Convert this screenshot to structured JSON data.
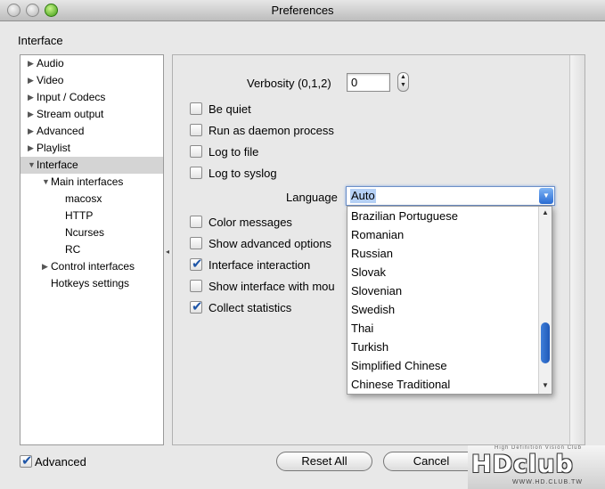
{
  "window": {
    "title": "Preferences"
  },
  "section_title": "Interface",
  "tree": [
    {
      "label": "Audio",
      "arrow": "▶",
      "level": 0,
      "selected": false
    },
    {
      "label": "Video",
      "arrow": "▶",
      "level": 0,
      "selected": false
    },
    {
      "label": "Input / Codecs",
      "arrow": "▶",
      "level": 0,
      "selected": false
    },
    {
      "label": "Stream output",
      "arrow": "▶",
      "level": 0,
      "selected": false
    },
    {
      "label": "Advanced",
      "arrow": "▶",
      "level": 0,
      "selected": false
    },
    {
      "label": "Playlist",
      "arrow": "▶",
      "level": 0,
      "selected": false
    },
    {
      "label": "Interface",
      "arrow": "▼",
      "level": 0,
      "selected": true
    },
    {
      "label": "Main interfaces",
      "arrow": "▼",
      "level": 1,
      "selected": false
    },
    {
      "label": "macosx",
      "arrow": "",
      "level": 2,
      "selected": false
    },
    {
      "label": "HTTP",
      "arrow": "",
      "level": 2,
      "selected": false
    },
    {
      "label": "Ncurses",
      "arrow": "",
      "level": 2,
      "selected": false
    },
    {
      "label": "RC",
      "arrow": "",
      "level": 2,
      "selected": false
    },
    {
      "label": "Control interfaces",
      "arrow": "▶",
      "level": 1,
      "selected": false
    },
    {
      "label": "Hotkeys settings",
      "arrow": "",
      "level": 1,
      "selected": false
    }
  ],
  "verbosity": {
    "label": "Verbosity (0,1,2)",
    "value": "0"
  },
  "options_top": [
    {
      "label": "Be quiet",
      "checked": false
    },
    {
      "label": "Run as daemon process",
      "checked": false
    },
    {
      "label": "Log to file",
      "checked": false
    },
    {
      "label": "Log to syslog",
      "checked": false
    }
  ],
  "language": {
    "label": "Language",
    "value": "Auto",
    "options": [
      "Brazilian Portuguese",
      "Romanian",
      "Russian",
      "Slovak",
      "Slovenian",
      "Swedish",
      "Thai",
      "Turkish",
      "Simplified Chinese",
      "Chinese Traditional"
    ]
  },
  "options_bottom": [
    {
      "label": "Color messages",
      "checked": false
    },
    {
      "label": "Show advanced options",
      "checked": false
    },
    {
      "label": "Interface interaction",
      "checked": true
    },
    {
      "label": "Show interface with mou",
      "checked": false
    },
    {
      "label": "Collect statistics",
      "checked": true
    }
  ],
  "footer": {
    "advanced_label": "Advanced",
    "advanced_checked": true,
    "reset_label": "Reset All",
    "cancel_label": "Cancel"
  },
  "watermark": {
    "tagline": "High Definition Vision Club",
    "logo": "HDclub",
    "url": "WWW.HD.CLUB.TW"
  }
}
